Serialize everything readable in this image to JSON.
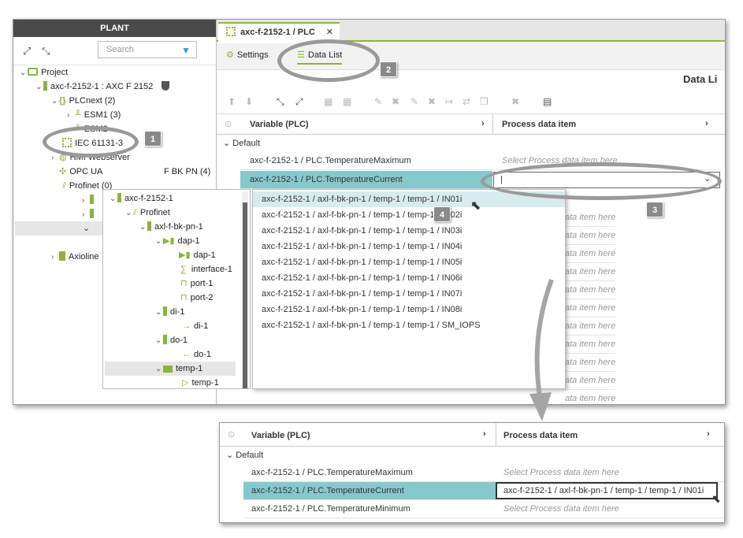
{
  "plant": {
    "title": "PLANT",
    "search_placeholder": "Search",
    "tree": [
      {
        "label": "Project"
      },
      {
        "label": "axc-f-2152-1 : AXC F 2152"
      },
      {
        "label": "PLCnext (2)"
      },
      {
        "label": "ESM1 (3)"
      },
      {
        "label": "ESM2"
      },
      {
        "label": "IEC 61131-3"
      },
      {
        "label": "HMI Webserver"
      },
      {
        "label": "OPC UA"
      },
      {
        "label": "Profinet (0)"
      },
      {
        "label": "Axioline"
      }
    ],
    "truncated_right": "F BK PN (4)"
  },
  "doc_tab": {
    "label": "axc-f-2152-1 / PLC"
  },
  "subtabs": {
    "settings": "Settings",
    "data_list": "Data List"
  },
  "page_title": "Data Li",
  "grid": {
    "col_variable": "Variable (PLC)",
    "col_process": "Process data item",
    "group": "Default",
    "rows": [
      {
        "variable": "axc-f-2152-1 / PLC.TemperatureMaximum",
        "process": "Select Process data item here"
      },
      {
        "variable": "axc-f-2152-1 / PLC.TemperatureCurrent",
        "process": "|"
      }
    ],
    "placeholder": "ata item here"
  },
  "dropdown": {
    "items": [
      "axc-f-2152-1 / axl-f-bk-pn-1 / temp-1 / temp-1 / IN01i",
      "axc-f-2152-1 / axl-f-bk-pn-1 / temp-1 / temp-1 / IN02i",
      "axc-f-2152-1 / axl-f-bk-pn-1 / temp-1 / temp-1 / IN03i",
      "axc-f-2152-1 / axl-f-bk-pn-1 / temp-1 / temp-1 / IN04i",
      "axc-f-2152-1 / axl-f-bk-pn-1 / temp-1 / temp-1 / IN05i",
      "axc-f-2152-1 / axl-f-bk-pn-1 / temp-1 / temp-1 / IN06i",
      "axc-f-2152-1 / axl-f-bk-pn-1 / temp-1 / temp-1 / IN07i",
      "axc-f-2152-1 / axl-f-bk-pn-1 / temp-1 / temp-1 / IN08i",
      "axc-f-2152-1 / axl-f-bk-pn-1 / temp-1 / temp-1 / SM_IOPS"
    ]
  },
  "tree2": {
    "items": [
      "axc-f-2152-1",
      "Profinet",
      "axl-f-bk-pn-1",
      "dap-1",
      "dap-1",
      "interface-1",
      "port-1",
      "port-2",
      "di-1",
      "di-1",
      "do-1",
      "do-1",
      "temp-1",
      "temp-1"
    ]
  },
  "bottom": {
    "col_variable": "Variable (PLC)",
    "col_process": "Process data item",
    "group": "Default",
    "rows": [
      {
        "variable": "axc-f-2152-1 / PLC.TemperatureMaximum",
        "process": "Select Process data item here"
      },
      {
        "variable": "axc-f-2152-1 / PLC.TemperatureCurrent",
        "process": "axc-f-2152-1 / axl-f-bk-pn-1 / temp-1 / temp-1 / IN01i"
      },
      {
        "variable": "axc-f-2152-1 / PLC.TemperatureMinimum",
        "process": "Select Process data item here"
      }
    ]
  },
  "callouts": [
    "1",
    "2",
    "3",
    "4"
  ],
  "colors": {
    "accent": "#8cb43c",
    "selection": "#86c9cc",
    "callout": "#8a8a8a"
  }
}
